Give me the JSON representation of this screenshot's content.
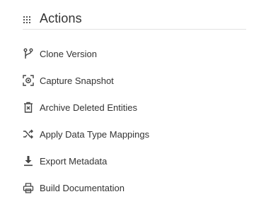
{
  "panel": {
    "title": "Actions",
    "title_icon": "grip-dots-icon",
    "items": [
      {
        "label": "Clone Version",
        "icon": "branch-icon"
      },
      {
        "label": "Capture Snapshot",
        "icon": "camera-snapshot-icon"
      },
      {
        "label": "Archive Deleted Entities",
        "icon": "archive-trash-icon"
      },
      {
        "label": "Apply Data Type Mappings",
        "icon": "shuffle-icon"
      },
      {
        "label": "Export Metadata",
        "icon": "download-icon"
      },
      {
        "label": "Build Documentation",
        "icon": "print-icon"
      }
    ]
  },
  "colors": {
    "text": "#333333",
    "divider": "#e2e2e2",
    "background": "#ffffff"
  }
}
